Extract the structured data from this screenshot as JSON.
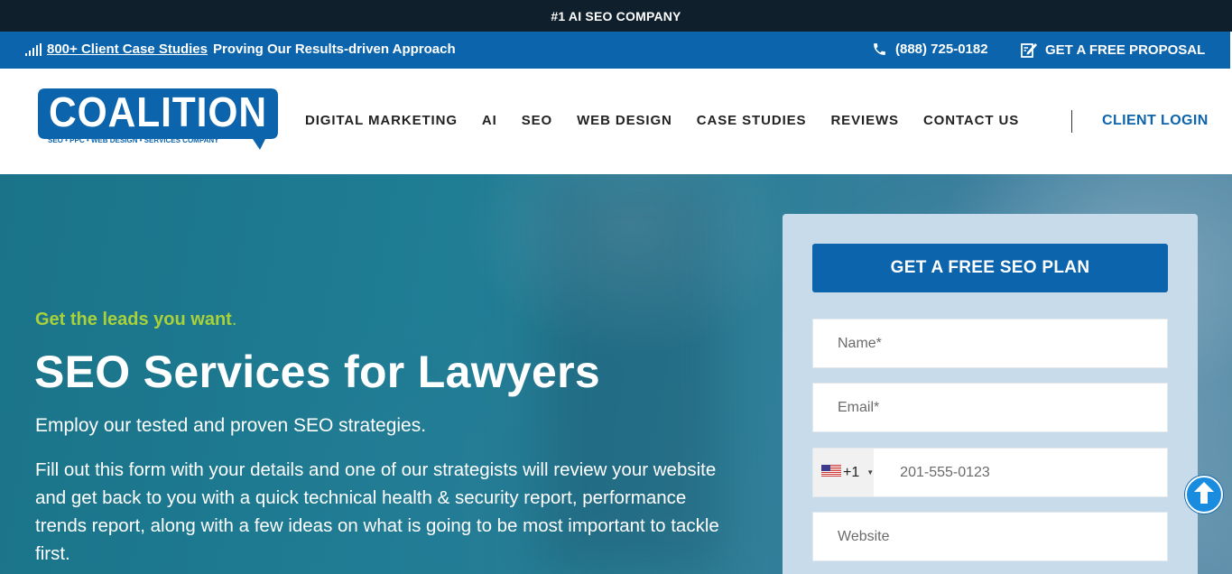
{
  "topbar": {
    "text": "#1 AI SEO COMPANY"
  },
  "infobar": {
    "case_studies_link": "800+ Client Case Studies",
    "case_studies_suffix": "Proving Our Results-driven Approach",
    "phone": "(888) 725-0182",
    "proposal": "GET A FREE PROPOSAL",
    "icons": [
      "signal-bars-icon",
      "phone-icon",
      "edit-document-icon"
    ]
  },
  "logo": {
    "name": "COALITION",
    "tagline": "SEO • PPC • WEB DESIGN • SERVICES COMPANY"
  },
  "nav": {
    "items": [
      "DIGITAL MARKETING",
      "AI",
      "SEO",
      "WEB DESIGN",
      "CASE STUDIES",
      "REVIEWS",
      "CONTACT US"
    ],
    "login": "CLIENT LOGIN"
  },
  "hero": {
    "tagline": "Get the leads you want",
    "tagline_dot": ".",
    "headline": "SEO Services for Lawyers",
    "lead": "Employ our tested and proven SEO strategies.",
    "paragraph": "Fill out this form with your details and one of our strategists will review your website and get back to you with a quick technical health & security report, performance trends report, along with a few ideas on what is going to be most important to tackle first."
  },
  "form": {
    "button": "GET A FREE SEO PLAN",
    "name_placeholder": "Name*",
    "email_placeholder": "Email*",
    "country_code": "+1",
    "phone_placeholder": "201-555-0123",
    "website_placeholder": "Website"
  },
  "colors": {
    "brand_blue": "#0b64ac",
    "dark_bar": "#0f202c",
    "accent_green": "#a9d13a"
  }
}
